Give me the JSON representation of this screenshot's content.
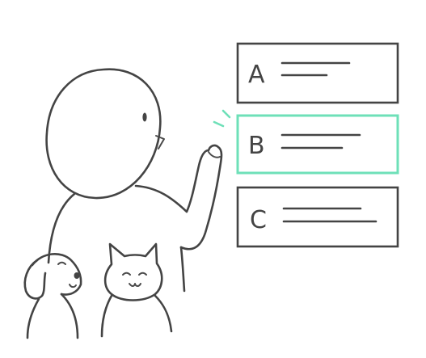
{
  "options": [
    {
      "letter": "A",
      "selected": false
    },
    {
      "letter": "B",
      "selected": true
    },
    {
      "letter": "C",
      "selected": false
    }
  ],
  "colors": {
    "ink": "#444444",
    "highlight": "#6ee0b8",
    "background": "#ffffff"
  },
  "icons": {
    "person": "pointing-person-icon",
    "dog": "dog-icon",
    "cat": "cat-icon",
    "emphasis": "emphasis-marks-icon"
  }
}
